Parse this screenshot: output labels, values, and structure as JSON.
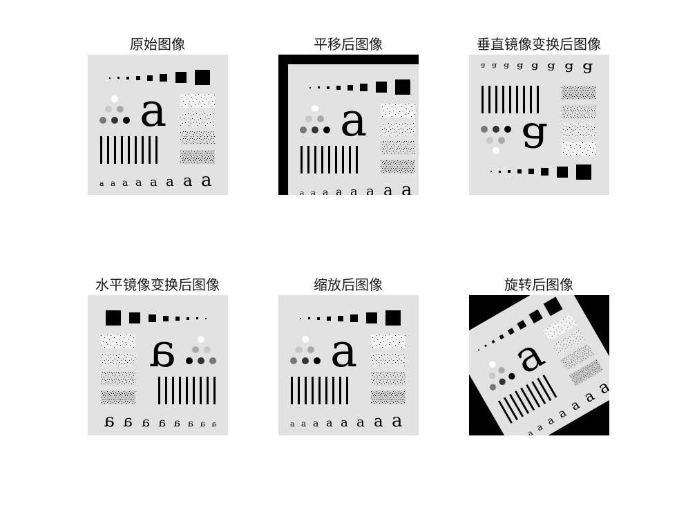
{
  "panels": [
    {
      "title": "原始图像"
    },
    {
      "title": "平移后图像"
    },
    {
      "title": "垂直镜像变换后图像"
    },
    {
      "title": "水平镜像变换后图像"
    },
    {
      "title": "缩放后图像"
    },
    {
      "title": "旋转后图像"
    }
  ],
  "colors": {
    "background": "#e2e2e2",
    "foreground": "#000000",
    "frame": "#000000"
  }
}
